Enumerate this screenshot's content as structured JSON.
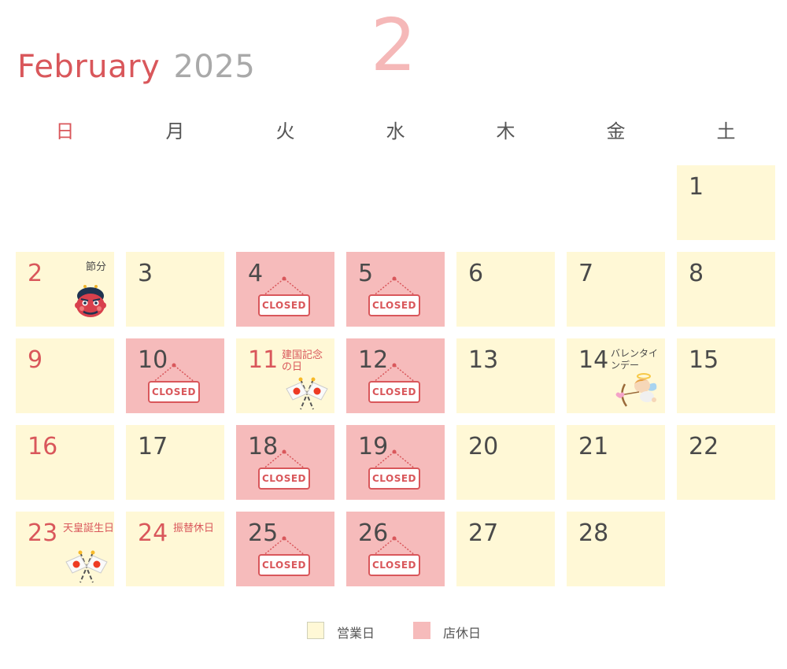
{
  "header": {
    "month_name": "February",
    "year": "2025",
    "month_number": "2"
  },
  "weekdays": [
    "日",
    "月",
    "火",
    "水",
    "木",
    "金",
    "土"
  ],
  "closed_sign_label": "CLOSED",
  "colors": {
    "open": "#fff8d6",
    "closed": "#f6bbbb",
    "accent_red": "#d9575b",
    "big_number": "#f5b8b8"
  },
  "days": [
    {
      "day": "1",
      "status": "open"
    },
    {
      "day": "2",
      "status": "open",
      "holiday": true,
      "note": "節分",
      "icon": "oni-demon-icon"
    },
    {
      "day": "3",
      "status": "open"
    },
    {
      "day": "4",
      "status": "closed"
    },
    {
      "day": "5",
      "status": "closed"
    },
    {
      "day": "6",
      "status": "open"
    },
    {
      "day": "7",
      "status": "open"
    },
    {
      "day": "8",
      "status": "open"
    },
    {
      "day": "9",
      "status": "open",
      "holiday": true
    },
    {
      "day": "10",
      "status": "closed"
    },
    {
      "day": "11",
      "status": "open",
      "holiday": true,
      "note": "建国記念の日",
      "icon": "japan-flags-icon"
    },
    {
      "day": "12",
      "status": "closed"
    },
    {
      "day": "13",
      "status": "open"
    },
    {
      "day": "14",
      "status": "open",
      "note": "バレンタインデー",
      "icon": "cupid-icon"
    },
    {
      "day": "15",
      "status": "open"
    },
    {
      "day": "16",
      "status": "open",
      "holiday": true
    },
    {
      "day": "17",
      "status": "open"
    },
    {
      "day": "18",
      "status": "closed"
    },
    {
      "day": "19",
      "status": "closed"
    },
    {
      "day": "20",
      "status": "open"
    },
    {
      "day": "21",
      "status": "open"
    },
    {
      "day": "22",
      "status": "open"
    },
    {
      "day": "23",
      "status": "open",
      "holiday": true,
      "note": "天皇誕生日",
      "icon": "japan-flags-icon"
    },
    {
      "day": "24",
      "status": "open",
      "holiday": true,
      "note": "振替休日"
    },
    {
      "day": "25",
      "status": "closed"
    },
    {
      "day": "26",
      "status": "closed"
    },
    {
      "day": "27",
      "status": "open"
    },
    {
      "day": "28",
      "status": "open"
    }
  ],
  "legend": [
    {
      "label": "営業日",
      "status": "open"
    },
    {
      "label": "店休日",
      "status": "closed"
    }
  ]
}
